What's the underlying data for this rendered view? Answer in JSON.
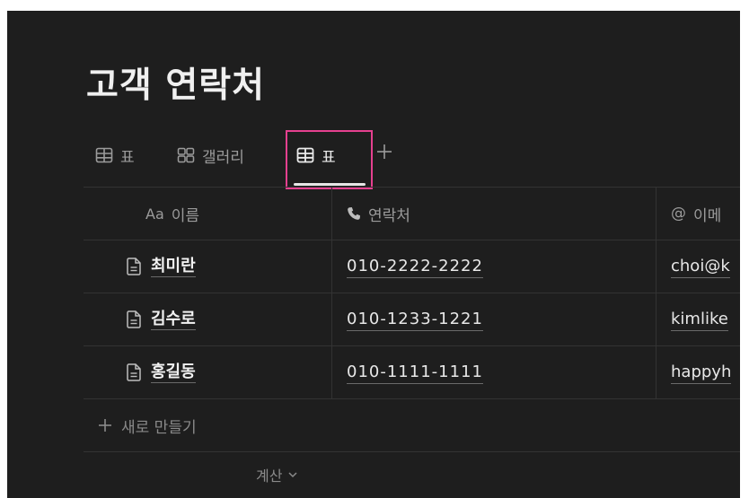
{
  "page": {
    "title": "고객 연락처"
  },
  "views": {
    "tabs": [
      {
        "icon": "table-icon",
        "label": "표"
      },
      {
        "icon": "gallery-icon",
        "label": "갤러리"
      },
      {
        "icon": "table-icon",
        "label": "표",
        "active": true
      }
    ],
    "add_icon": "plus-icon"
  },
  "table": {
    "columns": [
      {
        "icon_text": "Aa",
        "label": "이름"
      },
      {
        "icon": "phone-icon",
        "label": "연락처"
      },
      {
        "icon_text": "@",
        "label": "이메"
      }
    ],
    "rows": [
      {
        "name": "최미란",
        "phone": "010-2222-2222",
        "email": "choi@k"
      },
      {
        "name": "김수로",
        "phone": "010-1233-1221",
        "email": "kimlike"
      },
      {
        "name": "홍길동",
        "phone": "010-1111-1111",
        "email": "happyh"
      }
    ],
    "new_row_label": "새로 만들기",
    "calc_label": "계산"
  },
  "colors": {
    "background": "#1e1e1e",
    "highlight": "#e5408f",
    "text": "#e8e8e8",
    "muted": "#9b9b9b"
  }
}
